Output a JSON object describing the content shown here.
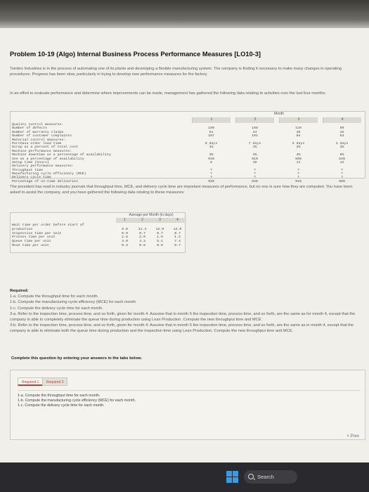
{
  "problem": {
    "title": "Problem 10-19 (Algo) Internal Business Process Performance Measures [LO10-3]",
    "intro": "Tombro Industries is in the process of automating one of its plants and developing a flexible manufacturing system. The company is finding it necessary to make many changes in operating procedures. Progress has been slow, particularly in trying to develop new performance measures for the factory.",
    "effort": "In an effort to evaluate performance and determine where improvements can be made, management has gathered the following data relating to activities over the last four months:",
    "president": "The president has read in industry journals that throughput time, MCE, and delivery cycle time are important measures of performance, but no one is sure how they are computed. You have been asked to assist the company, and you have gathered the following data relating to these measures:"
  },
  "table1": {
    "month_header": "Month",
    "columns": [
      "1",
      "2",
      "3",
      "4"
    ],
    "labels": [
      "Quality control measures:",
      "  Number of defects",
      "  Number of warranty claims",
      "  Number of customer complaints",
      "Material control measures:",
      "  Purchase order lead time",
      "  Scrap as a percent of total cost",
      "Machine performance measures:",
      "  Machine downtime as a percentage of availability",
      "  Use as a percentage of availability",
      "  Setup time (hours)",
      "Delivery performance measures:",
      "  Throughput time",
      "  Manufacturing cycle efficiency (MCE)",
      "  Delivery cycle time",
      "  Percentage of on-time deliveries"
    ],
    "values": [
      [
        "",
        "190",
        "51",
        "107",
        "",
        "8 days",
        "1%",
        "",
        "3%",
        "94%",
        "8",
        "",
        "?",
        "?",
        "?",
        "93%"
      ],
      [
        "",
        "168",
        "44",
        "101",
        "",
        "7 days",
        "1%",
        "",
        "4%",
        "91%",
        "10",
        "",
        "?",
        "?",
        "?",
        "94%"
      ],
      [
        "",
        "129",
        "35",
        "84",
        "",
        "5 days",
        "2%",
        "",
        "4%",
        "88%",
        "11",
        "",
        "?",
        "?",
        "?",
        "91%"
      ],
      [
        "",
        "90",
        "32",
        "63",
        "",
        "4 days",
        "3%",
        "",
        "6%",
        "84%",
        "12",
        "",
        "?",
        "?",
        "?",
        "88%"
      ]
    ]
  },
  "table2": {
    "header": "Average per Month (in days)",
    "columns": [
      "1",
      "2",
      "3",
      "4"
    ],
    "labels": [
      "Wait time per order before start of",
      "  production",
      "Inspection time per unit",
      "Process time per unit",
      "Queue time per unit",
      "Move time per unit"
    ],
    "values": [
      [
        "",
        "9.0",
        "0.9",
        "2.8",
        "3.0",
        "0.3"
      ],
      [
        "",
        "11.4",
        "0.7",
        "2.0",
        "4.3",
        "0.6"
      ],
      [
        "",
        "12.0",
        "0.7",
        "1.6",
        "5.1",
        "0.6"
      ],
      [
        "",
        "14.0",
        "0.7",
        "1.2",
        "7.4",
        "0.7"
      ]
    ]
  },
  "required": {
    "heading": "Required:",
    "items": [
      "1-a. Compute the throughput time for each month.",
      "1-b. Compute the manufacturing cycle efficiency (MCE) for each month.",
      "1-c. Compute the delivery cycle time for each month.",
      "3-a. Refer to the inspection time, process time, and so forth, given for month 4. Assume that in month 5 the inspection time, process time, and so forth, are the same as for month 4, except that the company is able to completely eliminate the queue time during production using Lean Production. Compute the new throughput time and MCE.",
      "3-b. Refer to the inspection time, process time, and so forth, given for month 4. Assume that in month 6 the inspection time, process time, and so forth, are the same as in month 4, except that the company is able to eliminate both the queue time during production and the inspection time using Lean Production. Compute the new throughput time and MCE."
    ]
  },
  "instruction": "Complete this question by entering your answers in the tabs below.",
  "tabs": [
    {
      "label": "Required 1",
      "active": true
    },
    {
      "label": "Required 3",
      "active": false
    }
  ],
  "tab_content": [
    "1-a. Compute the throughput time for each month.",
    "1-b. Compute the manufacturing cycle efficiency (MCE) for each month.",
    "1-c. Compute the delivery cycle time for each month."
  ],
  "nav": {
    "prev_label": "< Prev"
  },
  "taskbar": {
    "search_label": "Search"
  }
}
